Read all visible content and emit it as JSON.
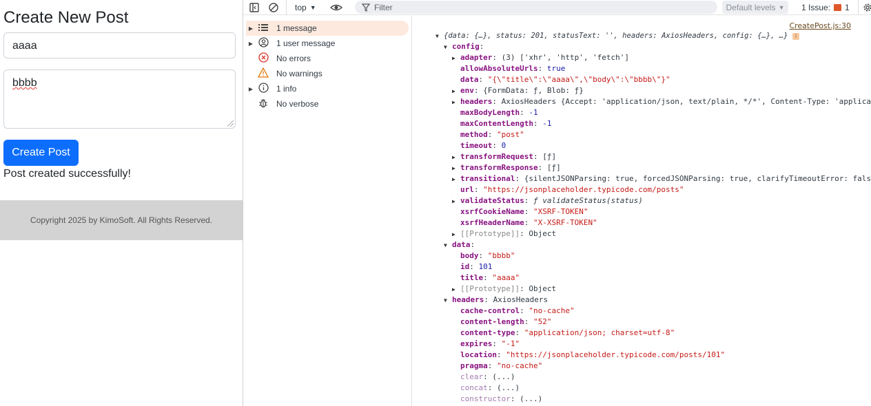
{
  "app": {
    "heading": "Create New Post",
    "title_value": "aaaa",
    "body_value": "bbbb",
    "submit_label": "Create Post",
    "success_message": "Post created successfully!",
    "footer_text": "Copyright 2025 by KimoSoft. All Rights Reserved."
  },
  "toolbar": {
    "context": "top",
    "filter_placeholder": "Filter",
    "levels": "Default levels",
    "issues": "1 Issue:",
    "issue_count": "1"
  },
  "sidebar": [
    {
      "label": "1 message",
      "icon": "list-icon"
    },
    {
      "label": "1 user message",
      "icon": "user-icon"
    },
    {
      "label": "No errors",
      "icon": "error-icon"
    },
    {
      "label": "No warnings",
      "icon": "warning-icon"
    },
    {
      "label": "1 info",
      "icon": "info-icon"
    },
    {
      "label": "No verbose",
      "icon": "bug-icon"
    }
  ],
  "console": {
    "source": "CreatePost.js:30",
    "summary": "{data: {…}, status: 201, statusText: '', headers: AxiosHeaders, config: {…}, …}",
    "lines": [
      {
        "i": 1,
        "t": "open",
        "k": "config",
        "v": "",
        "vc": ""
      },
      {
        "i": 2,
        "t": "closed",
        "k": "adapter",
        "v": "(3) ['xhr', 'http', 'fetch']",
        "vc": "o"
      },
      {
        "i": 2,
        "t": "",
        "k": "allowAbsoluteUrls",
        "v": "true",
        "vc": "n"
      },
      {
        "i": 2,
        "t": "",
        "k": "data",
        "v": "\"{\\\"title\\\":\\\"aaaa\\\",\\\"body\\\":\\\"bbbb\\\"}\"",
        "vc": "s"
      },
      {
        "i": 2,
        "t": "closed",
        "k": "env",
        "v": "{FormData: ƒ, Blob: ƒ}",
        "vc": "o"
      },
      {
        "i": 2,
        "t": "closed",
        "k": "headers",
        "v": "AxiosHeaders {Accept: 'application/json, text/plain, */*', Content-Type: 'application",
        "vc": "o"
      },
      {
        "i": 2,
        "t": "",
        "k": "maxBodyLength",
        "v": "-1",
        "vc": "n"
      },
      {
        "i": 2,
        "t": "",
        "k": "maxContentLength",
        "v": "-1",
        "vc": "n"
      },
      {
        "i": 2,
        "t": "",
        "k": "method",
        "v": "\"post\"",
        "vc": "s"
      },
      {
        "i": 2,
        "t": "",
        "k": "timeout",
        "v": "0",
        "vc": "n"
      },
      {
        "i": 2,
        "t": "closed",
        "k": "transformRequest",
        "v": "[ƒ]",
        "vc": "o"
      },
      {
        "i": 2,
        "t": "closed",
        "k": "transformResponse",
        "v": "[ƒ]",
        "vc": "o"
      },
      {
        "i": 2,
        "t": "closed",
        "k": "transitional",
        "v": "{silentJSONParsing: true, forcedJSONParsing: true, clarifyTimeoutError: false}",
        "vc": "o"
      },
      {
        "i": 2,
        "t": "",
        "k": "url",
        "v": "\"https://jsonplaceholder.typicode.com/posts\"",
        "vc": "s"
      },
      {
        "i": 2,
        "t": "closed",
        "k": "validateStatus",
        "v": "ƒ validateStatus(status)",
        "vc": "o it"
      },
      {
        "i": 2,
        "t": "",
        "k": "xsrfCookieName",
        "v": "\"XSRF-TOKEN\"",
        "vc": "s"
      },
      {
        "i": 2,
        "t": "",
        "k": "xsrfHeaderName",
        "v": "\"X-XSRF-TOKEN\"",
        "vc": "s"
      },
      {
        "i": 2,
        "t": "closed",
        "k": "[[Prototype]]",
        "v": "Object",
        "vc": "o",
        "kc": "g"
      },
      {
        "i": 1,
        "t": "open",
        "k": "data",
        "v": "",
        "vc": ""
      },
      {
        "i": 2,
        "t": "",
        "k": "body",
        "v": "\"bbbb\"",
        "vc": "s"
      },
      {
        "i": 2,
        "t": "",
        "k": "id",
        "v": "101",
        "vc": "n"
      },
      {
        "i": 2,
        "t": "",
        "k": "title",
        "v": "\"aaaa\"",
        "vc": "s"
      },
      {
        "i": 2,
        "t": "closed",
        "k": "[[Prototype]]",
        "v": "Object",
        "vc": "o",
        "kc": "g"
      },
      {
        "i": 1,
        "t": "open",
        "k": "headers",
        "v": "AxiosHeaders",
        "vc": "o"
      },
      {
        "i": 2,
        "t": "",
        "k": "cache-control",
        "v": "\"no-cache\"",
        "vc": "s"
      },
      {
        "i": 2,
        "t": "",
        "k": "content-length",
        "v": "\"52\"",
        "vc": "s"
      },
      {
        "i": 2,
        "t": "",
        "k": "content-type",
        "v": "\"application/json; charset=utf-8\"",
        "vc": "s"
      },
      {
        "i": 2,
        "t": "",
        "k": "expires",
        "v": "\"-1\"",
        "vc": "s"
      },
      {
        "i": 2,
        "t": "",
        "k": "location",
        "v": "\"https://jsonplaceholder.typicode.com/posts/101\"",
        "vc": "s"
      },
      {
        "i": 2,
        "t": "",
        "k": "pragma",
        "v": "\"no-cache\"",
        "vc": "s"
      },
      {
        "i": 2,
        "t": "",
        "k": "clear",
        "v": "(...)",
        "vc": "o",
        "kc": "kp"
      },
      {
        "i": 2,
        "t": "",
        "k": "concat",
        "v": "(...)",
        "vc": "o",
        "kc": "kp"
      },
      {
        "i": 2,
        "t": "",
        "k": "constructor",
        "v": "(...)",
        "vc": "o",
        "kc": "kp"
      }
    ]
  }
}
